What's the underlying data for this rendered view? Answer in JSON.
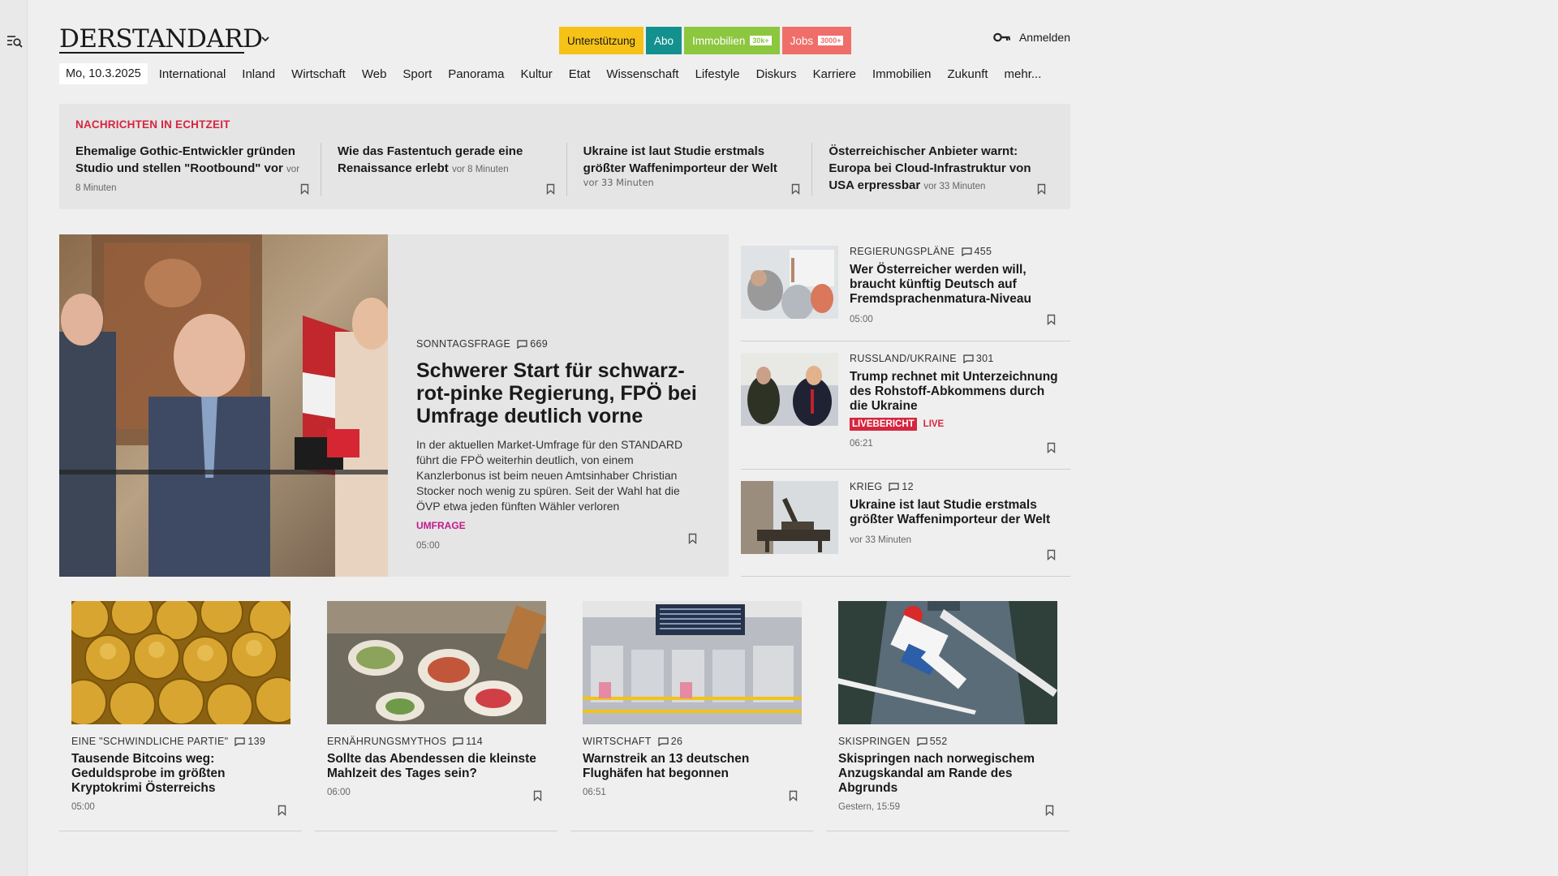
{
  "header": {
    "logo": "DERSTANDARD",
    "login_label": "Anmelden",
    "pills": {
      "support": "Unterstützung",
      "abo": "Abo",
      "immo": "Immobilien",
      "immo_badge": "30k+",
      "jobs": "Jobs",
      "jobs_badge": "3000+"
    }
  },
  "nav": {
    "date": "Mo, 10.3.2025",
    "items": [
      "International",
      "Inland",
      "Wirtschaft",
      "Web",
      "Sport",
      "Panorama",
      "Kultur",
      "Etat",
      "Wissenschaft",
      "Lifestyle",
      "Diskurs",
      "Karriere",
      "Immobilien",
      "Zukunft",
      "mehr..."
    ]
  },
  "ticker": {
    "label": "NACHRICHTEN IN ECHTZEIT",
    "items": [
      {
        "title": "Ehemalige Gothic-Entwickler gründen Studio und stellen \"Rootbound\" vor",
        "time": "vor 8 Minuten"
      },
      {
        "title": "Wie das Fastentuch gerade eine Renaissance erlebt",
        "time": "vor 8 Minuten"
      },
      {
        "title": "Ukraine ist laut Studie erstmals größter Waffenimporteur der Welt",
        "time": "vor 33 Minuten"
      },
      {
        "title": "Österreichischer Anbieter warnt: Europa bei Cloud-Infrastruktur von USA erpressbar",
        "time": "vor 33 Minuten"
      }
    ]
  },
  "hero": {
    "kicker": "SONNTAGSFRAGE",
    "comments": "669",
    "title": "Schwerer Start für schwarz-rot-pinke Regierung, FPÖ bei Umfrage deutlich vorne",
    "teaser": "In der aktuellen Market-Umfrage für den STANDARD führt die FPÖ weiterhin deutlich, von einem Kanzlerbonus ist beim neuen Amtsinhaber Christian Stocker noch wenig zu spüren. Seit der Wahl hat die ÖVP etwa jeden fünften Wähler verloren",
    "tag": "UMFRAGE",
    "time": "05:00"
  },
  "side": [
    {
      "kicker": "REGIERUNGSPLÄNE",
      "comments": "455",
      "title": "Wer Österreicher werden will, braucht künftig Deutsch auf Fremdsprachenmatura-Niveau",
      "time": "05:00"
    },
    {
      "kicker": "RUSSLAND/UKRAINE",
      "comments": "301",
      "title": "Trump rechnet mit Unterzeichnung des Rohstoff-Abkommens durch die Ukraine",
      "live_badge": "LIVEBERICHT",
      "live_word": "LIVE",
      "time": "06:21"
    },
    {
      "kicker": "KRIEG",
      "comments": "12",
      "title": "Ukraine ist laut Studie erstmals größter Waffenimporteur der Welt",
      "time": "vor 33 Minuten"
    }
  ],
  "cards": [
    {
      "kicker": "EINE \"SCHWINDLICHE PARTIE\"",
      "comments": "139",
      "title": "Tausende Bitcoins weg: Geduldsprobe im größten Kryptokrimi Österreichs",
      "time": "05:00"
    },
    {
      "kicker": "ERNÄHRUNGSMYTHOS",
      "comments": "114",
      "title": "Sollte das Abendessen die kleinste Mahlzeit des Tages sein?",
      "time": "06:00"
    },
    {
      "kicker": "WIRTSCHAFT",
      "comments": "26",
      "title": "Warnstreik an 13 deutschen Flughäfen hat begonnen",
      "time": "06:51"
    },
    {
      "kicker": "SKISPRINGEN",
      "comments": "552",
      "title": "Skispringen nach norwegischem Anzugskandal am Rande des Abgrunds",
      "time": "Gestern, 15:59"
    }
  ],
  "colors": {
    "live_red": "#d6263f",
    "support_yellow": "#f6c218",
    "abo_teal": "#13918f",
    "immo_green": "#8dc63f",
    "jobs_red": "#ef6e6a",
    "umfrage_magenta": "#c1198b"
  },
  "icons": {
    "sidebar": "search-menu-icon",
    "login": "key-icon",
    "bookmark": "bookmark-icon",
    "comments": "comment-icon",
    "logo_menu": "chevron-down-icon"
  }
}
